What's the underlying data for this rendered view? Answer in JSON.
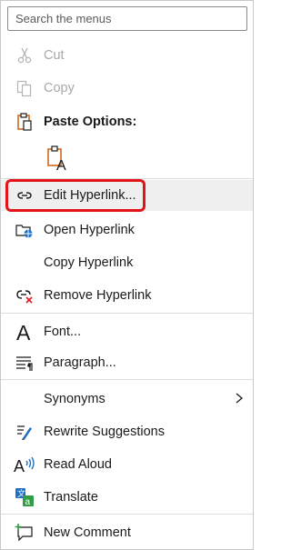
{
  "search": {
    "placeholder": "Search the menus"
  },
  "items": {
    "cut": "Cut",
    "copy": "Copy",
    "paste_options": "Paste Options:",
    "edit_hyperlink": "Edit Hyperlink...",
    "open_hyperlink": "Open Hyperlink",
    "copy_hyperlink": "Copy Hyperlink",
    "remove_hyperlink": "Remove Hyperlink",
    "font": "Font...",
    "paragraph": "Paragraph...",
    "synonyms": "Synonyms",
    "rewrite_suggestions": "Rewrite Suggestions",
    "read_aloud": "Read Aloud",
    "translate": "Translate",
    "new_comment": "New Comment"
  },
  "icons": {
    "cut": "scissors-icon",
    "copy": "copy-icon",
    "paste": "clipboard-icon",
    "paste_keep_text": "paste-text-only-icon",
    "edit_hyperlink": "link-icon",
    "open_hyperlink": "open-link-icon",
    "remove_hyperlink": "remove-link-icon",
    "font": "font-icon",
    "paragraph": "paragraph-icon",
    "synonyms_submenu": "chevron-right-icon",
    "rewrite": "rewrite-icon",
    "read_aloud": "read-aloud-icon",
    "translate": "translate-icon",
    "new_comment": "new-comment-icon"
  },
  "colors": {
    "highlight_border": "#e3131a",
    "hover_bg": "#efefef",
    "disabled_text": "#a8a8a8",
    "accent_blue": "#1e6fc6",
    "accent_orange": "#d2691e"
  }
}
